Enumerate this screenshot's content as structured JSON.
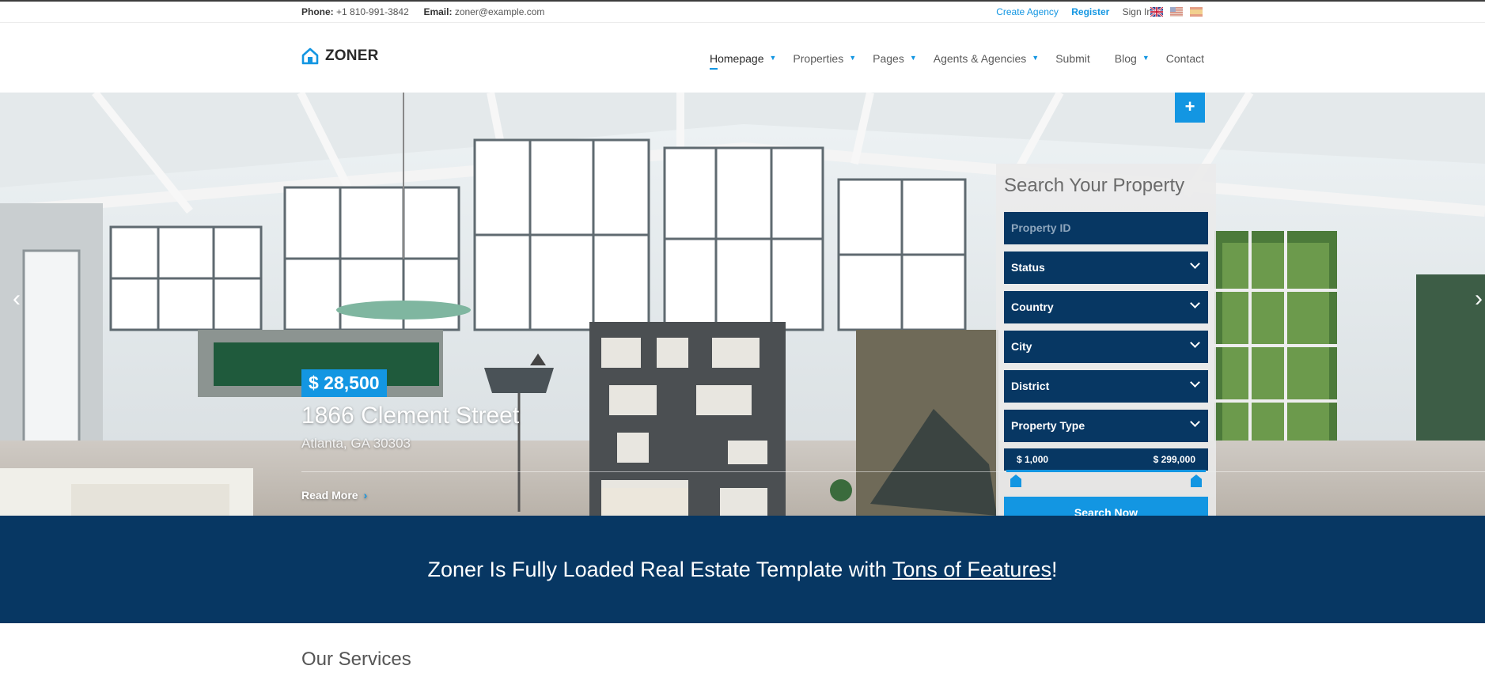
{
  "topbar": {
    "phone_label": "Phone:",
    "phone": "+1 810-991-3842",
    "email_label": "Email:",
    "email": "zoner@example.com",
    "create_agency": "Create Agency",
    "register": "Register",
    "sign_in": "Sign In",
    "flags": [
      "uk-flag-icon",
      "us-flag-icon",
      "es-flag-icon"
    ]
  },
  "brand": {
    "name": "ZONER",
    "icon": "house-icon",
    "color": "#1396e2"
  },
  "nav": {
    "items": [
      {
        "label": "Homepage",
        "dropdown": true,
        "active": true
      },
      {
        "label": "Properties",
        "dropdown": true
      },
      {
        "label": "Pages",
        "dropdown": true
      },
      {
        "label": "Agents & Agencies",
        "dropdown": true
      },
      {
        "label": "Submit",
        "dropdown": false
      },
      {
        "label": "Blog",
        "dropdown": true
      },
      {
        "label": "Contact",
        "dropdown": false
      }
    ]
  },
  "hero": {
    "price": "$ 28,500",
    "address": "1866 Clement Street",
    "city": "Atlanta, GA 30303",
    "read_more": "Read More",
    "prev_icon": "chevron-left-icon",
    "next_icon": "chevron-right-icon",
    "plus": "+"
  },
  "search": {
    "title": "Search Your Property",
    "property_id_placeholder": "Property ID",
    "selects": [
      "Status",
      "Country",
      "City",
      "District",
      "Property Type"
    ],
    "price_min": "$ 1,000",
    "price_max": "$ 299,000",
    "button": "Search Now"
  },
  "banner": {
    "text_before": "Zoner Is Fully Loaded Real Estate Template with ",
    "link": "Tons of Features",
    "text_after": "!"
  },
  "services": {
    "title": "Our Services"
  },
  "colors": {
    "accent": "#1396e2",
    "navy": "#073763"
  }
}
